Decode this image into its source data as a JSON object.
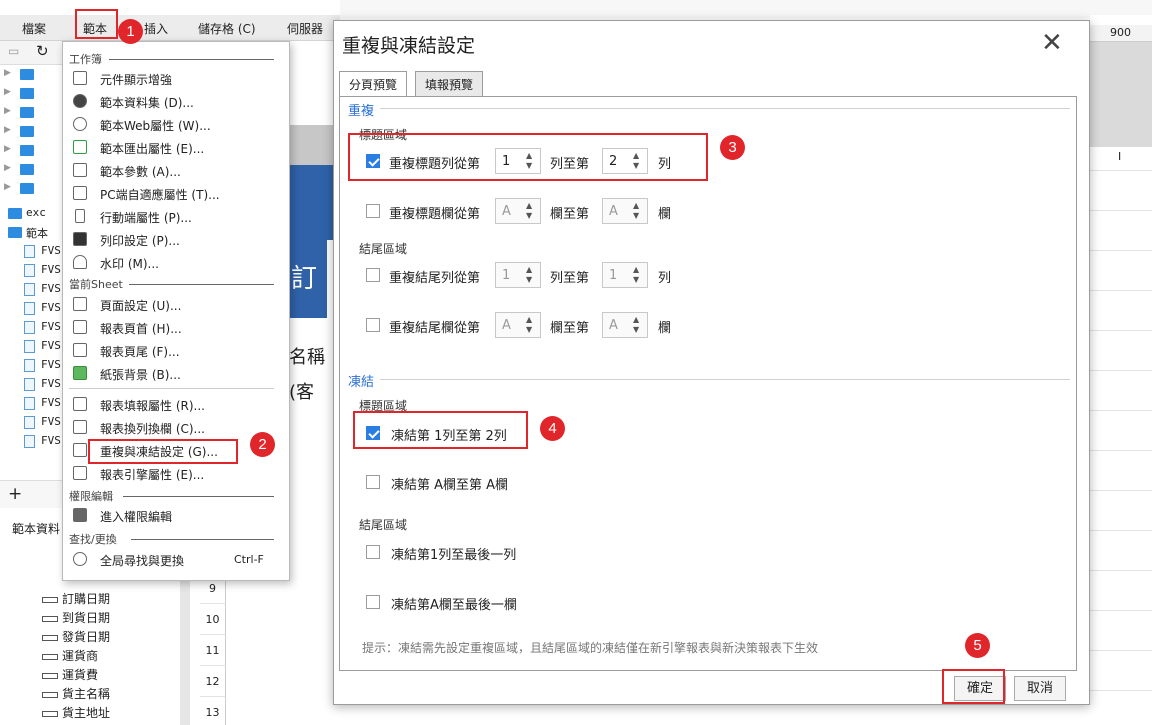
{
  "menubar": {
    "items": [
      "檔案",
      "範本",
      "插入",
      "儲存格 (C)",
      "伺服器"
    ]
  },
  "tree": {
    "top_items": [
      "exc",
      "範本"
    ],
    "files": [
      "FVS",
      "FVS",
      "FVS",
      "FVS",
      "FVS",
      "FVS",
      "FVS",
      "FVS",
      "FVS",
      "FVS",
      "FVS",
      "FVS"
    ]
  },
  "left_panel": {
    "add_label": "+",
    "ds_title": "範本資料",
    "fields": [
      "訂購日期",
      "到貨日期",
      "發貨日期",
      "運貨商",
      "運貨費",
      "貨主名稱",
      "貨主地址"
    ],
    "row_numbers": [
      "9",
      "10",
      "11",
      "12",
      "13"
    ]
  },
  "background": {
    "big_text": "訂",
    "text1": "名稱",
    "text2": "(客",
    "ruler_num": "900",
    "col_marker": "I"
  },
  "popup": {
    "section_workbook": "工作簿",
    "section_sheet": "當前Sheet",
    "section_perm": "權限編輯",
    "section_find": "查找/更換",
    "items_workbook": [
      "元件顯示增強",
      "範本資料集 (D)...",
      "範本Web屬性 (W)...",
      "範本匯出屬性 (E)...",
      "範本參數 (A)...",
      "PC端自適應屬性 (T)...",
      "行動端屬性 (P)...",
      "列印設定 (P)...",
      "水印 (M)..."
    ],
    "items_sheet": [
      "頁面設定 (U)...",
      "報表頁首 (H)...",
      "報表頁尾 (F)...",
      "紙張背景 (B)...",
      "報表填報屬性 (R)...",
      "報表換列換欄 (C)...",
      "重複與凍結設定 (G)...",
      "報表引擎屬性 (E)..."
    ],
    "items_perm": [
      "進入權限編輯"
    ],
    "items_find": [
      "全局尋找與更換"
    ],
    "find_shortcut": "Ctrl-F"
  },
  "markers": [
    "1",
    "2",
    "3",
    "4",
    "5"
  ],
  "dialog": {
    "title": "重複與凍結設定",
    "close_glyph": "✕",
    "tabs": [
      "分頁預覽",
      "填報預覽"
    ],
    "repeat": {
      "title": "重複",
      "header_title": "標題區域",
      "footer_title": "結尾區域",
      "row1": {
        "label": "重複標題列從第",
        "from": "1",
        "mid": "列至第",
        "to": "2",
        "end": "列",
        "checked": true
      },
      "row2": {
        "label": "重複標題欄從第",
        "from": "A",
        "mid": "欄至第",
        "to": "A",
        "end": "欄",
        "checked": false
      },
      "row3": {
        "label": "重複結尾列從第",
        "from": "1",
        "mid": "列至第",
        "to": "1",
        "end": "列",
        "checked": false
      },
      "row4": {
        "label": "重複結尾欄從第",
        "from": "A",
        "mid": "欄至第",
        "to": "A",
        "end": "欄",
        "checked": false
      }
    },
    "freeze": {
      "title": "凍結",
      "header_title": "標題區域",
      "footer_title": "結尾區域",
      "row1": {
        "label": "凍結第 1列至第 2列",
        "checked": true
      },
      "row2": {
        "label": "凍結第 A欄至第 A欄",
        "checked": false
      },
      "row3": {
        "label": "凍結第1列至最後一列",
        "checked": false
      },
      "row4": {
        "label": "凍結第A欄至最後一欄",
        "checked": false
      }
    },
    "hint": "提示：凍結需先設定重複區域，且結尾區域的凍結僅在新引擎報表與新決策報表下生效",
    "ok": "確定",
    "cancel": "取消"
  },
  "colors": {
    "accent": "#2a7de1",
    "marker": "#e0262a",
    "group_title": "#2a6fd6"
  }
}
